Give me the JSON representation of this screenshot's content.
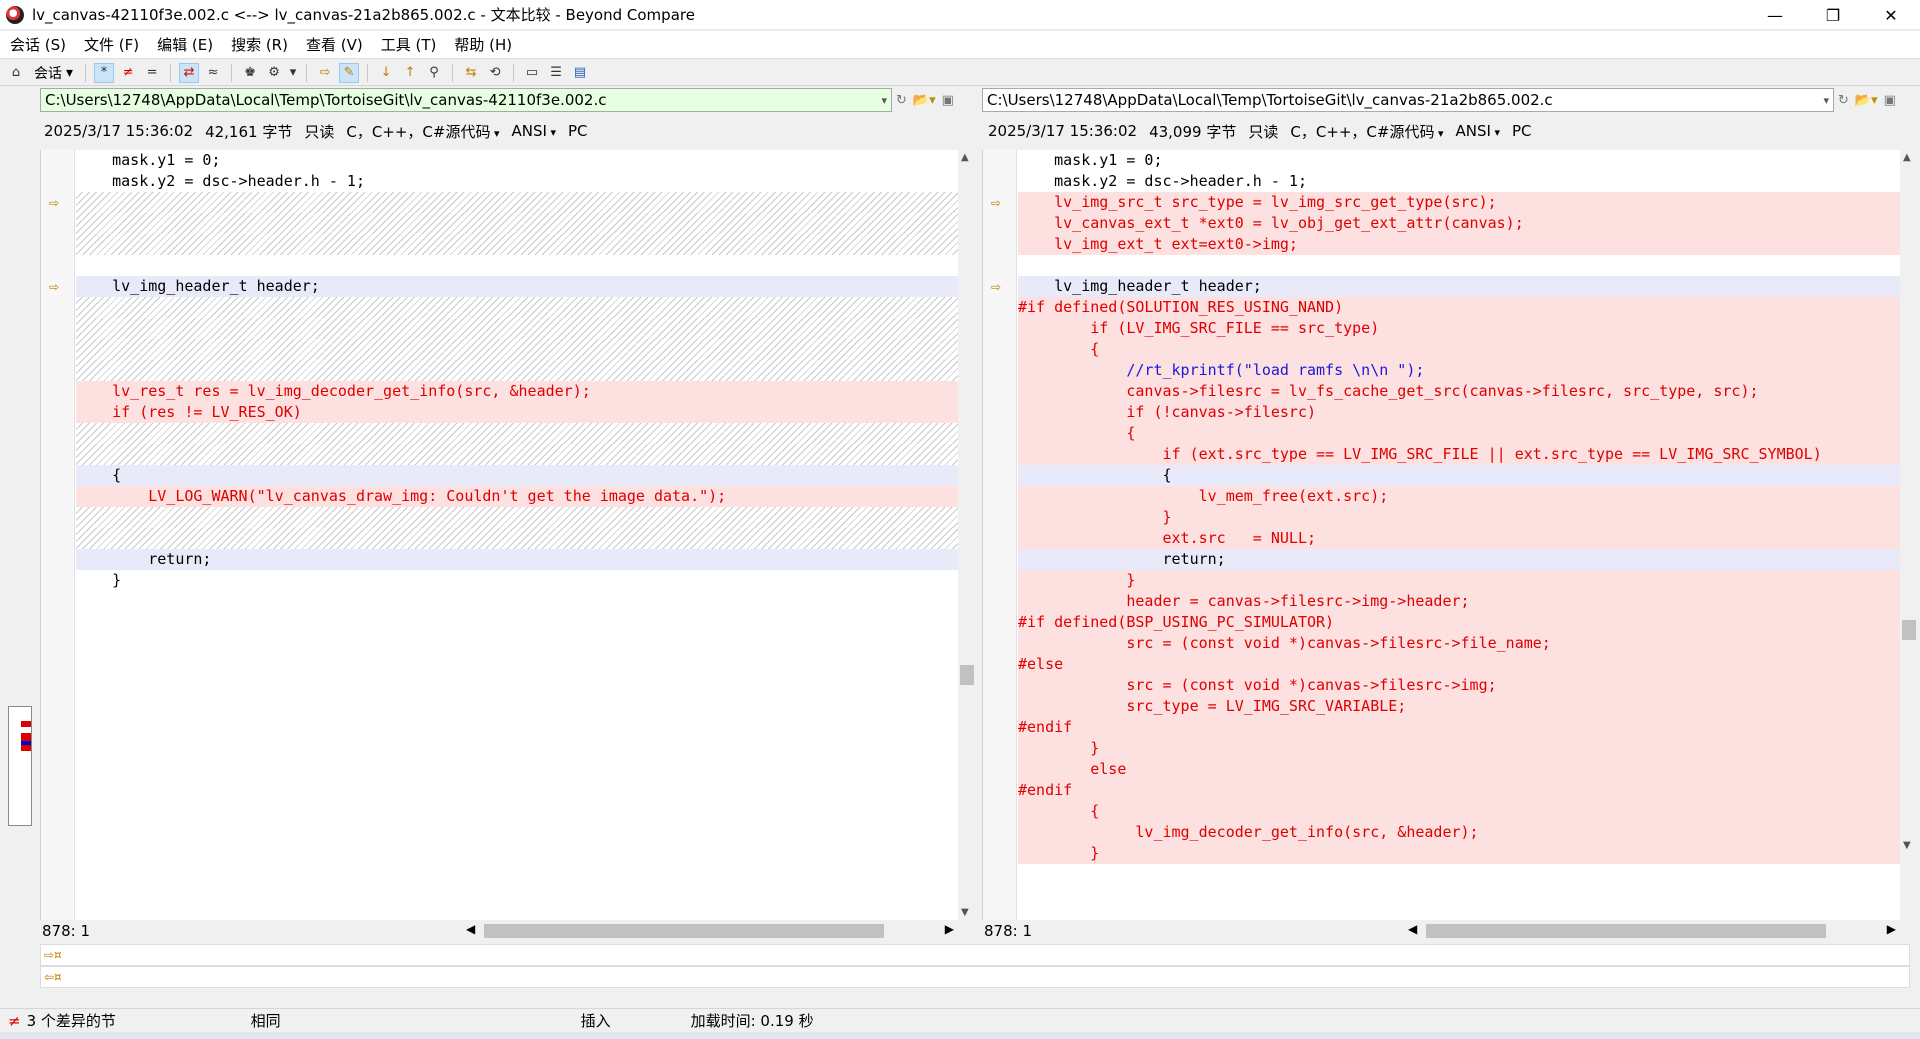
{
  "window": {
    "title": "lv_canvas-42110f3e.002.c <--> lv_canvas-21a2b865.002.c - 文本比较 - Beyond Compare",
    "minimize": "—",
    "restore": "❐",
    "close": "✕"
  },
  "menu": [
    "会话 (S)",
    "文件 (F)",
    "编辑 (E)",
    "搜索 (R)",
    "查看 (V)",
    "工具 (T)",
    "帮助 (H)"
  ],
  "toolbar": {
    "session_label": "会话"
  },
  "left": {
    "path": "C:\\Users\\12748\\AppData\\Local\\Temp\\TortoiseGit\\lv_canvas-42110f3e.002.c",
    "date": "2025/3/17 15:36:02",
    "size": "42,161 字节",
    "readonly": "只读",
    "format": "C，C++，C#源代码",
    "encoding": "ANSI",
    "lineend": "PC",
    "position": "878: 1"
  },
  "right": {
    "path": "C:\\Users\\12748\\AppData\\Local\\Temp\\TortoiseGit\\lv_canvas-21a2b865.002.c",
    "date": "2025/3/17 15:36:02",
    "size": "43,099 字节",
    "readonly": "只读",
    "format": "C，C++，C#源代码",
    "encoding": "ANSI",
    "lineend": "PC",
    "position": "878: 1"
  },
  "left_lines": [
    {
      "t": "same",
      "c": "    mask.y1 = 0;"
    },
    {
      "t": "same",
      "c": "    mask.y2 = dsc->header.h - 1;"
    },
    {
      "t": "gap",
      "c": "",
      "arrow": true
    },
    {
      "t": "gap",
      "c": ""
    },
    {
      "t": "gap",
      "c": ""
    },
    {
      "t": "empty",
      "c": ""
    },
    {
      "t": "mod",
      "c": "    lv_img_header_t header;",
      "arrow": true
    },
    {
      "t": "gap",
      "c": ""
    },
    {
      "t": "gap",
      "c": ""
    },
    {
      "t": "gap",
      "c": ""
    },
    {
      "t": "gap",
      "c": ""
    },
    {
      "t": "diff",
      "c": "    lv_res_t res = lv_img_decoder_get_info(src, &header);"
    },
    {
      "t": "diff",
      "c": "    if (res != LV_RES_OK)"
    },
    {
      "t": "gap",
      "c": ""
    },
    {
      "t": "gap",
      "c": ""
    },
    {
      "t": "mod",
      "c": "    {"
    },
    {
      "t": "diff",
      "c": "        LV_LOG_WARN(\"lv_canvas_draw_img: Couldn't get the image data.\");"
    },
    {
      "t": "gap",
      "c": ""
    },
    {
      "t": "gap",
      "c": ""
    },
    {
      "t": "mod",
      "c": "        return;"
    },
    {
      "t": "same",
      "c": "    }"
    }
  ],
  "right_lines": [
    {
      "t": "same",
      "c": "    mask.y1 = 0;"
    },
    {
      "t": "same",
      "c": "    mask.y2 = dsc->header.h - 1;"
    },
    {
      "t": "diff",
      "c": "    lv_img_src_t src_type = lv_img_src_get_type(src);",
      "arrow": true
    },
    {
      "t": "diff",
      "c": "    lv_canvas_ext_t *ext0 = lv_obj_get_ext_attr(canvas);"
    },
    {
      "t": "diff",
      "c": "    lv_img_ext_t ext=ext0->img;"
    },
    {
      "t": "empty",
      "c": ""
    },
    {
      "t": "mod",
      "c": "    lv_img_header_t header;",
      "arrow": true
    },
    {
      "t": "diff",
      "c": "#if defined(SOLUTION_RES_USING_NAND)"
    },
    {
      "t": "diff",
      "c": "        if (LV_IMG_SRC_FILE == src_type)"
    },
    {
      "t": "diff",
      "c": "        {"
    },
    {
      "t": "comment",
      "c": "            //rt_kprintf(\"load ramfs \\n\\n \");"
    },
    {
      "t": "diff",
      "c": "            canvas->filesrc = lv_fs_cache_get_src(canvas->filesrc, src_type, src);"
    },
    {
      "t": "diff",
      "c": "            if (!canvas->filesrc)"
    },
    {
      "t": "diff",
      "c": "            {"
    },
    {
      "t": "diff",
      "c": "                if (ext.src_type == LV_IMG_SRC_FILE || ext.src_type == LV_IMG_SRC_SYMBOL)"
    },
    {
      "t": "mod",
      "c": "                {"
    },
    {
      "t": "diff",
      "c": "                    lv_mem_free(ext.src);"
    },
    {
      "t": "diff",
      "c": "                }"
    },
    {
      "t": "diff",
      "c": "                ext.src   = NULL;"
    },
    {
      "t": "mod",
      "c": "                return;"
    },
    {
      "t": "diff",
      "c": "            }"
    },
    {
      "t": "diff",
      "c": "            header = canvas->filesrc->img->header;"
    },
    {
      "t": "diff",
      "c": "#if defined(BSP_USING_PC_SIMULATOR)"
    },
    {
      "t": "diff",
      "c": "            src = (const void *)canvas->filesrc->file_name;"
    },
    {
      "t": "diff",
      "c": "#else"
    },
    {
      "t": "diff",
      "c": "            src = (const void *)canvas->filesrc->img;"
    },
    {
      "t": "diff",
      "c": "            src_type = LV_IMG_SRC_VARIABLE;"
    },
    {
      "t": "diff",
      "c": "#endif"
    },
    {
      "t": "diff",
      "c": "        }"
    },
    {
      "t": "diff",
      "c": "        else"
    },
    {
      "t": "diff",
      "c": "#endif"
    },
    {
      "t": "diff",
      "c": "        {"
    },
    {
      "t": "diff",
      "c": "             lv_img_decoder_get_info(src, &header);"
    },
    {
      "t": "diff",
      "c": "        }"
    }
  ],
  "status": {
    "diffs": "3 个差异的节",
    "same": "相同",
    "mode": "插入",
    "load": "加载时间:  0.19 秒"
  }
}
